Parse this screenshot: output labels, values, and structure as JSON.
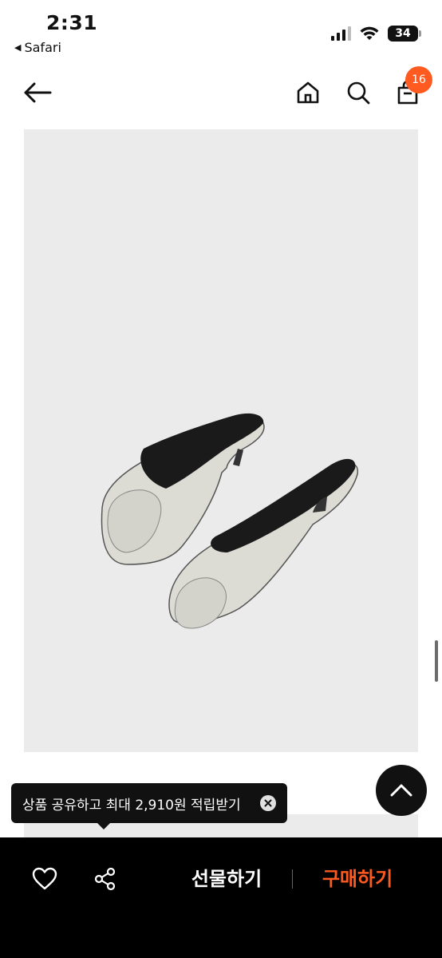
{
  "status_bar": {
    "time": "2:31",
    "back_app": "Safari",
    "battery": "34"
  },
  "nav": {
    "cart_count": "16"
  },
  "tooltip": {
    "text": "상품 공유하고 최대 2,910원 적립받기"
  },
  "bottom_bar": {
    "gift_label": "선물하기",
    "buy_label": "구매하기"
  },
  "colors": {
    "accent": "#ff5a1f",
    "image_bg": "#ebebeb",
    "bar_bg": "#000000"
  },
  "icons": [
    "back-arrow-icon",
    "home-icon",
    "search-icon",
    "shopping-bag-icon",
    "chevron-up-icon",
    "close-icon",
    "heart-icon",
    "share-icon"
  ]
}
